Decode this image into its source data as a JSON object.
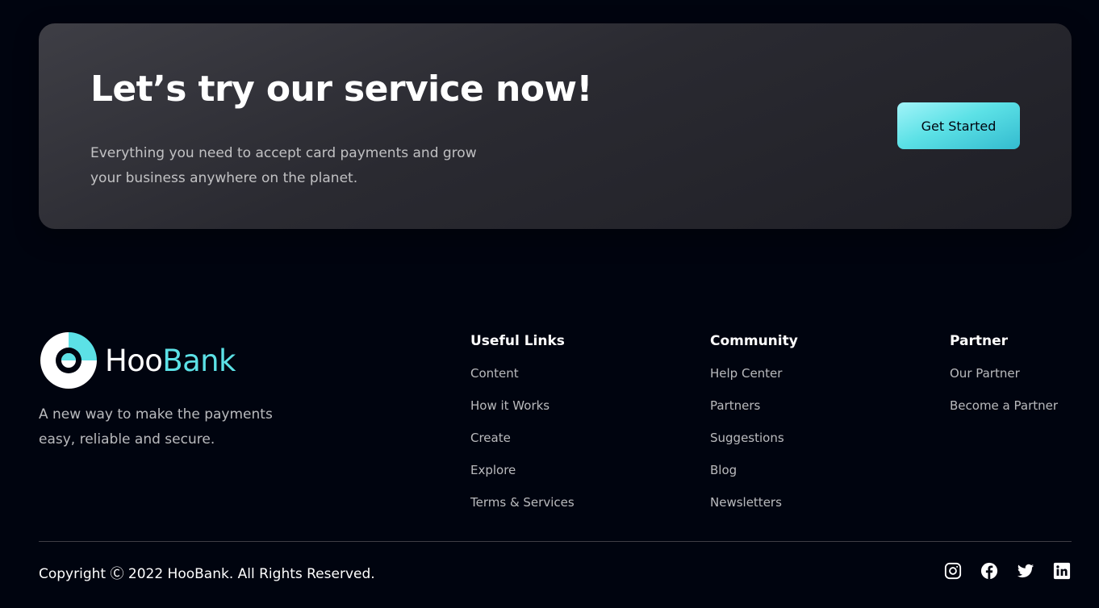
{
  "cta": {
    "title": "Let’s try our service now!",
    "text": "Everything you need to accept card payments and grow your business anywhere on the planet.",
    "button_label": "Get Started"
  },
  "footer": {
    "logo": {
      "part1": "Hoo",
      "part2": "Bank",
      "icon": "hoobank-logo-icon",
      "accent_color": "#5ce1e6"
    },
    "tagline": "A new way to make the payments easy, reliable and secure.",
    "columns": [
      {
        "title": "Useful Links",
        "links": [
          "Content",
          "How it Works",
          "Create",
          "Explore",
          "Terms & Services"
        ]
      },
      {
        "title": "Community",
        "links": [
          "Help Center",
          "Partners",
          "Suggestions",
          "Blog",
          "Newsletters"
        ]
      },
      {
        "title": "Partner",
        "links": [
          "Our Partner",
          "Become a Partner"
        ]
      }
    ],
    "copyright": "Copyright Ⓒ 2022 HooBank. All Rights Reserved.",
    "socials": [
      "instagram-icon",
      "facebook-icon",
      "twitter-icon",
      "linkedin-icon"
    ]
  },
  "colors": {
    "background": "#00040f",
    "accent": "#5ce1e6",
    "card": "#2f2f36"
  }
}
